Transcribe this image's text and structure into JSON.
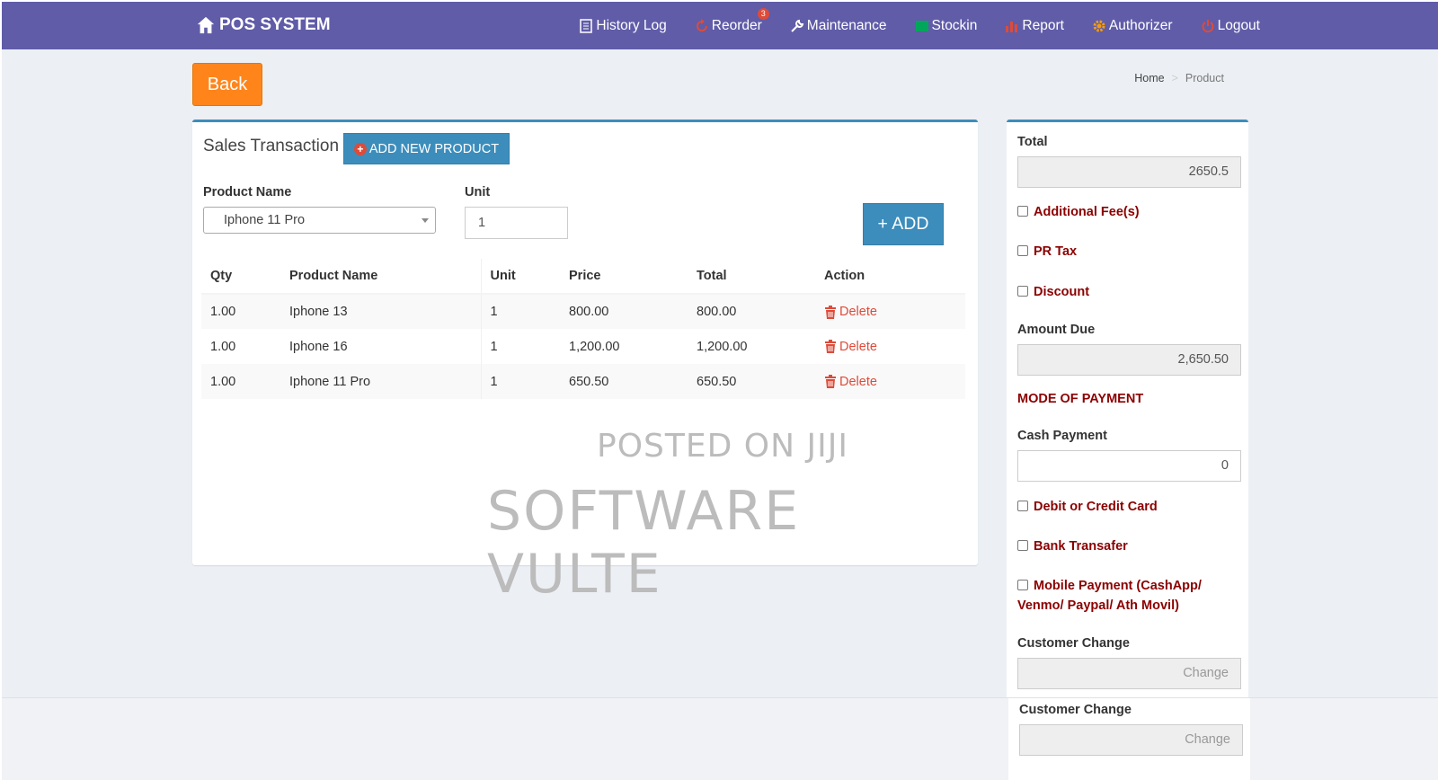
{
  "navbar": {
    "brand": "POS SYSTEM",
    "items": [
      {
        "label": "History Log",
        "icon": "list-icon"
      },
      {
        "label": "Reorder",
        "icon": "refresh-icon",
        "badge": "3"
      },
      {
        "label": "Maintenance",
        "icon": "wrench-icon"
      },
      {
        "label": "Stockin",
        "icon": "box-icon"
      },
      {
        "label": "Report",
        "icon": "bar-chart-icon"
      },
      {
        "label": "Authorizer",
        "icon": "gear-icon"
      },
      {
        "label": "Logout",
        "icon": "power-icon"
      }
    ]
  },
  "back_label": "Back",
  "breadcrumb": {
    "home": "Home",
    "current": "Product"
  },
  "transaction": {
    "title": "Sales Transaction",
    "add_new_product_label": "ADD NEW PRODUCT",
    "product_name_label": "Product Name",
    "product_selected": "Iphone 11 Pro",
    "unit_label": "Unit",
    "unit_value": "1",
    "add_label": "+ ADD",
    "columns": [
      "Qty",
      "Product Name",
      "Unit",
      "Price",
      "Total",
      "Action"
    ],
    "rows": [
      {
        "qty": "1.00",
        "name": "Iphone 13",
        "unit": "1",
        "price": "800.00",
        "total": "800.00",
        "action": "Delete"
      },
      {
        "qty": "1.00",
        "name": "Iphone 16",
        "unit": "1",
        "price": "1,200.00",
        "total": "1,200.00",
        "action": "Delete"
      },
      {
        "qty": "1.00",
        "name": "Iphone 11 Pro",
        "unit": "1",
        "price": "650.50",
        "total": "650.50",
        "action": "Delete"
      }
    ]
  },
  "watermark": {
    "line1": "POSTED ON JIJI",
    "line2": "SOFTWARE VULTE"
  },
  "summary": {
    "total_label": "Total",
    "total_value": "2650.5",
    "additional_fees_label": "Additional Fee(s)",
    "pr_tax_label": "PR Tax",
    "discount_label": "Discount",
    "amount_due_label": "Amount Due",
    "amount_due_value": "2,650.50",
    "mode_of_payment_label": "MODE OF PAYMENT",
    "cash_payment_label": "Cash Payment",
    "cash_payment_value": "0",
    "card_label": "Debit or Credit Card",
    "bank_label": "Bank Transafer",
    "mobile_label_line1": "Mobile Payment (CashApp/",
    "mobile_label_line2": "Venmo/ Paypal/ Ath Movil)",
    "customer_change_label": "Customer Change",
    "customer_change_placeholder": "Change"
  },
  "footer": {
    "customer_change_label": "Customer Change",
    "customer_change_placeholder": "Change"
  },
  "colors": {
    "navbar": "#605ca8",
    "primary": "#3c8dbc",
    "back": "#ff851b",
    "danger": "#dd4b39",
    "label_dark_red": "#8b0000"
  }
}
